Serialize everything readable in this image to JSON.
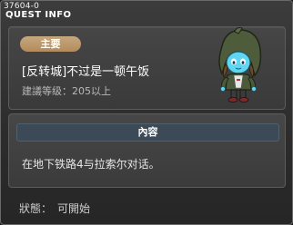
{
  "window": {
    "quest_id": "37604-0",
    "title": "QUEST INFO"
  },
  "header": {
    "badge_label": "主要",
    "quest_name": "[反转城]不过是一顿午饭",
    "level_requirement": "建議等级：205以上"
  },
  "content": {
    "section_label": "內容",
    "description": "在地下铁路4与拉索尔对话。"
  },
  "status": {
    "label": "狀態：",
    "value": "可開始"
  },
  "colors": {
    "badge": "#b99167",
    "content_header": "#3b4a56",
    "panel": "#404040"
  }
}
